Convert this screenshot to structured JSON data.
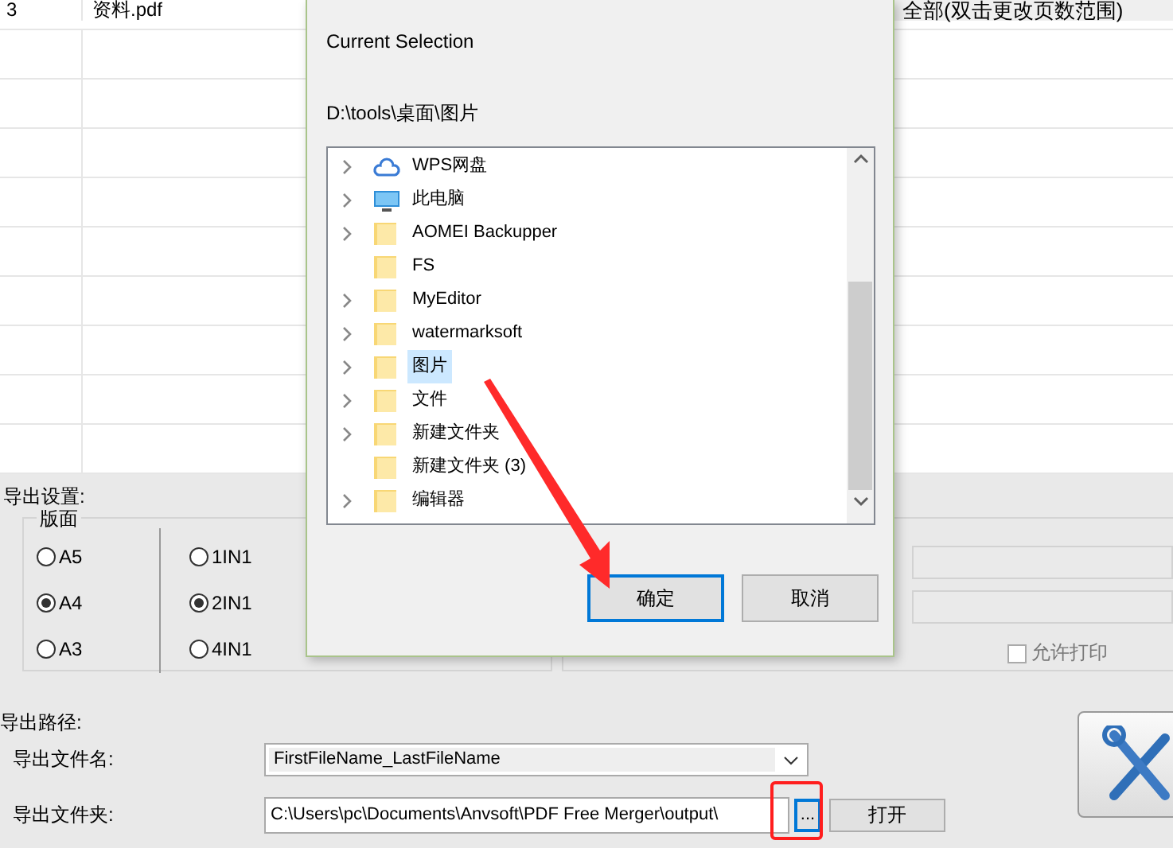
{
  "file_table": {
    "row": {
      "index": "3",
      "name": "资料.pdf",
      "page_range": "全部(双击更改页数范围)"
    }
  },
  "export_settings": {
    "title": "导出设置:",
    "page_size": {
      "label": "版面",
      "options": [
        {
          "label": "A5",
          "selected": false
        },
        {
          "label": "A4",
          "selected": true
        },
        {
          "label": "A3",
          "selected": false
        }
      ]
    },
    "layout": {
      "options": [
        {
          "label": "1IN1",
          "selected": false
        },
        {
          "label": "2IN1",
          "selected": true
        },
        {
          "label": "4IN1",
          "selected": false
        }
      ]
    },
    "allow_print": {
      "label": "允许打印",
      "checked": false
    }
  },
  "export_path": {
    "title": "导出路径:",
    "filename": {
      "label": "导出文件名:",
      "value": "FirstFileName_LastFileName"
    },
    "folder": {
      "label": "导出文件夹:",
      "value": "C:\\Users\\pc\\Documents\\Anvsoft\\PDF Free Merger\\output\\",
      "browse": "...",
      "open": "打开"
    }
  },
  "dialog": {
    "heading": "Current Selection",
    "path": "D:\\tools\\桌面\\图片",
    "tree": [
      {
        "label": "WPS网盘",
        "kind": "cloud",
        "expandable": true,
        "selected": false
      },
      {
        "label": "此电脑",
        "kind": "computer",
        "expandable": true,
        "selected": false
      },
      {
        "label": "AOMEI Backupper",
        "kind": "folder",
        "expandable": true,
        "selected": false
      },
      {
        "label": "FS",
        "kind": "folder",
        "expandable": false,
        "selected": false
      },
      {
        "label": "MyEditor",
        "kind": "folder",
        "expandable": true,
        "selected": false
      },
      {
        "label": "watermarksoft",
        "kind": "folder",
        "expandable": true,
        "selected": false
      },
      {
        "label": "图片",
        "kind": "folder",
        "expandable": true,
        "selected": true
      },
      {
        "label": "文件",
        "kind": "folder",
        "expandable": true,
        "selected": false
      },
      {
        "label": "新建文件夹",
        "kind": "folder",
        "expandable": true,
        "selected": false
      },
      {
        "label": "新建文件夹 (3)",
        "kind": "folder",
        "expandable": false,
        "selected": false
      },
      {
        "label": "编辑器",
        "kind": "folder",
        "expandable": true,
        "selected": false
      }
    ],
    "buttons": [
      {
        "label": "确定",
        "default": true
      },
      {
        "label": "取消",
        "default": false
      }
    ]
  }
}
